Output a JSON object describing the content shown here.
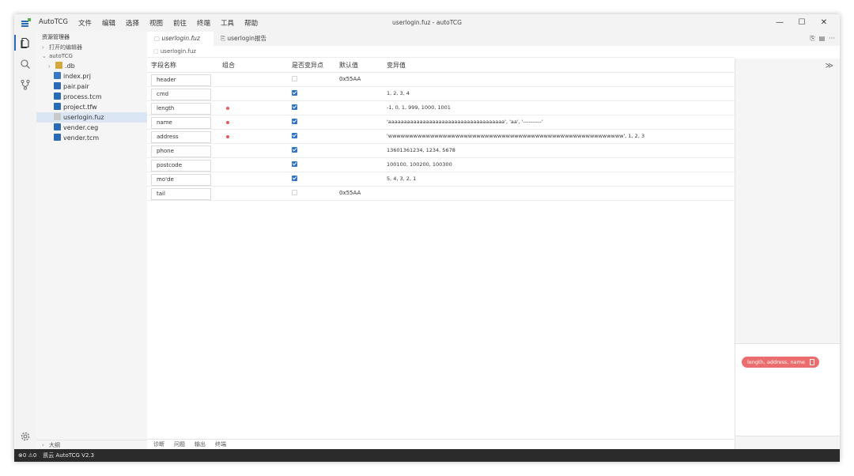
{
  "window": {
    "title": "userlogin.fuz - autoTCG",
    "controls": [
      "—",
      "☐",
      "✕"
    ]
  },
  "menu": [
    "AutoTCG",
    "文件",
    "编辑",
    "选择",
    "视图",
    "前往",
    "终端",
    "工具",
    "帮助"
  ],
  "sidebar": {
    "title": "资源管理器",
    "open_editors": "打开的编辑器",
    "project": "autoTCG",
    "folder": ".db",
    "files": [
      {
        "name": "index.prj",
        "color": "#3a78c3"
      },
      {
        "name": "pair.pair",
        "color": "#2b6bb5"
      },
      {
        "name": "process.tcm",
        "color": "#2b6bb5"
      },
      {
        "name": "project.tfw",
        "color": "#2b6bb5"
      },
      {
        "name": "userlogin.fuz",
        "color": "#c9c9c9"
      },
      {
        "name": "vender.ceg",
        "color": "#2b6bb5"
      },
      {
        "name": "vender.tcm",
        "color": "#2b6bb5"
      }
    ],
    "outline": "大纲"
  },
  "tabs": [
    {
      "label": "userlogin.fuz"
    },
    {
      "label": "userlogin报告"
    }
  ],
  "tab_actions": [
    "⎘",
    "▤",
    "···"
  ],
  "breadcrumb": "userlogin.fuz",
  "grid": {
    "headers": [
      "字段名称",
      "组合",
      "是否变异点",
      "默认值",
      "变异值"
    ],
    "rows": [
      {
        "name": "header",
        "combo": false,
        "mut": false,
        "default": "0x55AA",
        "values": ""
      },
      {
        "name": "cmd",
        "combo": false,
        "mut": true,
        "default": "",
        "values": "1, 2, 3, 4"
      },
      {
        "name": "length",
        "combo": true,
        "mut": true,
        "default": "",
        "values": "-1, 0, 1, 999, 1000, 1001"
      },
      {
        "name": "name",
        "combo": true,
        "mut": true,
        "default": "",
        "values": "'aaaaaaaaaaaaaaaaaaaaaaaaaaaaaaaaaaaaa', 'aa', '----------'"
      },
      {
        "name": "address",
        "combo": true,
        "mut": true,
        "default": "",
        "values": "'wwwwwwwwwwwwwwwwwwwwwwwwwwwwwwwwwwwwwwwwwwwwwwwwwwwwwwww', 1, 2, 3"
      },
      {
        "name": "phone",
        "combo": false,
        "mut": true,
        "default": "",
        "values": "13601361234, 1234, 5678"
      },
      {
        "name": "postcode",
        "combo": false,
        "mut": true,
        "default": "",
        "values": "100100, 100200, 100300"
      },
      {
        "name": "mo'de",
        "combo": false,
        "mut": true,
        "default": "",
        "values": "5, 4, 3, 2, 1"
      },
      {
        "name": "tail",
        "combo": false,
        "mut": false,
        "default": "0x55AA",
        "values": ""
      }
    ]
  },
  "right_panel": {
    "collapse": "≫",
    "chip": "length, address, name"
  },
  "panel_tabs": [
    "诊断",
    "问题",
    "输出",
    "终端"
  ],
  "statusbar": {
    "problems": "⊗0 ⚠0",
    "product": "凯云 AutoTCG V2.3"
  },
  "colors": {
    "accent": "#2f74c6",
    "combo_dot": "#e85858",
    "chip": "#ec6d6d",
    "statusbar": "#2b2b2b"
  }
}
